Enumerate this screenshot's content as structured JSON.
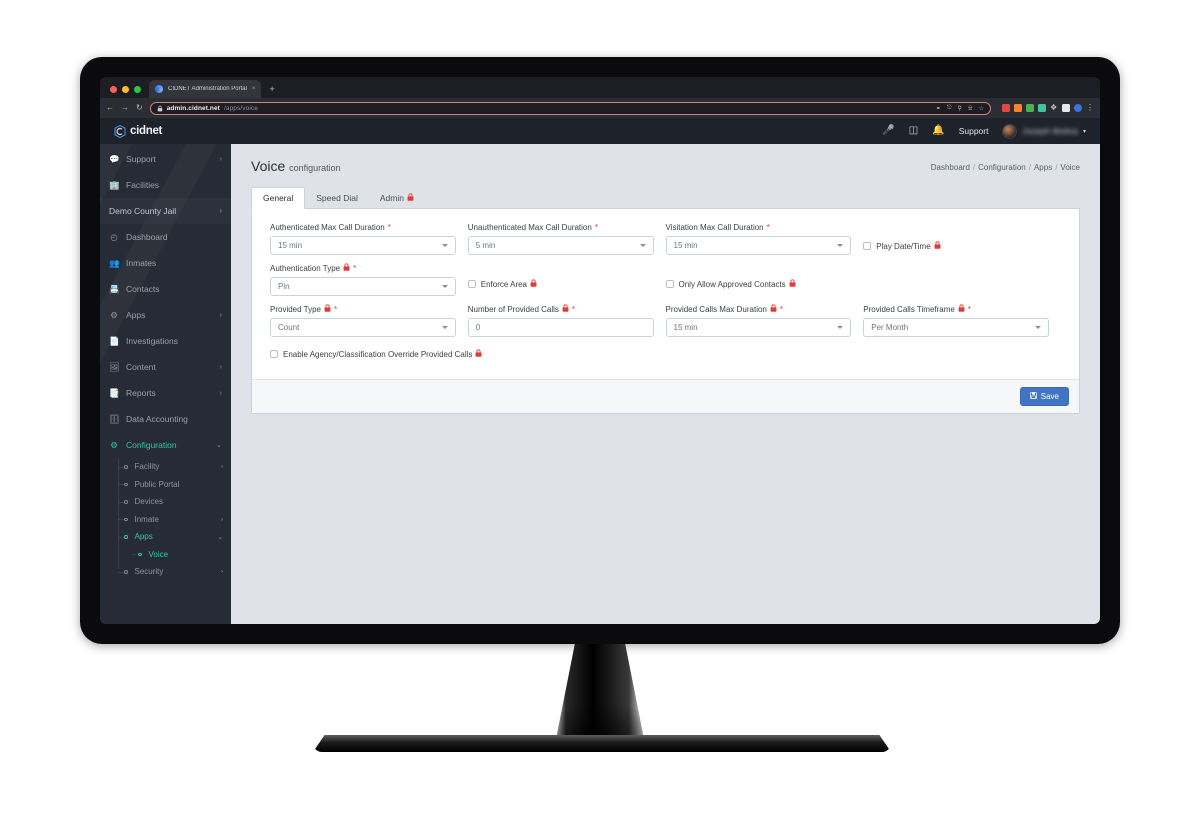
{
  "browser": {
    "tab_title": "CIDNET Administration Portal",
    "tab_close": "×",
    "new_tab": "+",
    "back": "←",
    "forward": "→",
    "reload": "↻",
    "lock_icon": "ὑ2",
    "url_host": "admin.cidnet.net",
    "url_path": "/apps/voice",
    "omni_icons": [
      "key-icon",
      "share-icon",
      "zoom-icon",
      "print-icon",
      "bookmark-star-icon"
    ],
    "ext_icons": [
      "red-extension",
      "orange-extension",
      "green-extension",
      "teal-extension",
      "puzzle-extension",
      "white-extension",
      "blue-profile",
      "kebab-menu"
    ]
  },
  "app": {
    "logo_text": "cidnet",
    "header_icons": [
      "microphone-icon",
      "package-icon",
      "bell-icon"
    ],
    "support_label": "Support",
    "user_name": "Joseph Molina",
    "user_caret": "▾"
  },
  "sidebar": {
    "items": [
      {
        "label": "Support",
        "icon": "💬",
        "chevron": "›",
        "type": "item"
      },
      {
        "label": "Facilities",
        "icon": "🏢",
        "chevron": "",
        "type": "item"
      },
      {
        "label": "Demo County Jail",
        "icon": "",
        "chevron": "›",
        "type": "site"
      },
      {
        "label": "Dashboard",
        "icon": "◴",
        "chevron": "",
        "type": "item"
      },
      {
        "label": "Inmates",
        "icon": "👥",
        "chevron": "",
        "type": "item"
      },
      {
        "label": "Contacts",
        "icon": "📇",
        "chevron": "",
        "type": "item"
      },
      {
        "label": "Apps",
        "icon": "⚙",
        "chevron": "›",
        "type": "item"
      },
      {
        "label": "Investigations",
        "icon": "📄",
        "chevron": "",
        "type": "item"
      },
      {
        "label": "Content",
        "icon": "🖼",
        "chevron": "›",
        "type": "item"
      },
      {
        "label": "Reports",
        "icon": "📑",
        "chevron": "›",
        "type": "item"
      },
      {
        "label": "Data Accounting",
        "icon": "🗄",
        "chevron": "",
        "type": "item"
      },
      {
        "label": "Configuration",
        "icon": "⚙",
        "chevron": "⌄",
        "type": "group-open"
      }
    ],
    "sub_items": [
      {
        "label": "Facility",
        "chevron": "›",
        "state": "off",
        "level": 1
      },
      {
        "label": "Public Portal",
        "chevron": "",
        "state": "off",
        "level": 1
      },
      {
        "label": "Devices",
        "chevron": "",
        "state": "off",
        "level": 1
      },
      {
        "label": "Inmate",
        "chevron": "›",
        "state": "off",
        "level": 1
      },
      {
        "label": "Apps",
        "chevron": "⌄",
        "state": "on",
        "level": 1
      },
      {
        "label": "Voice",
        "chevron": "",
        "state": "current",
        "level": 2
      },
      {
        "label": "Security",
        "chevron": "›",
        "state": "off",
        "level": 1
      }
    ]
  },
  "page": {
    "title_main": "Voice",
    "title_sub": "configuration",
    "breadcrumb": [
      "Dashboard",
      "Configuration",
      "Apps",
      "Voice"
    ],
    "breadcrumb_sep": "/"
  },
  "tabs": [
    {
      "label": "General",
      "selected": true,
      "lock": false
    },
    {
      "label": "Speed Dial",
      "selected": false,
      "lock": false
    },
    {
      "label": "Admin",
      "selected": false,
      "lock": true
    }
  ],
  "form": {
    "lock_glyph": "🔒",
    "required_glyph": "*",
    "fields": {
      "authenticated_max_call_duration": {
        "label": "Authenticated Max Call Duration",
        "value": "15 min",
        "required": true,
        "lock": false,
        "control": "select"
      },
      "unauthenticated_max_call_duration": {
        "label": "Unauthenticated Max Call Duration",
        "value": "5 min",
        "required": true,
        "lock": false,
        "control": "select"
      },
      "visitation_max_call_duration": {
        "label": "Visitation Max Call Duration",
        "value": "15 min",
        "required": true,
        "lock": false,
        "control": "select"
      },
      "play_date_time": {
        "label": "Play Date/Time",
        "checked": false,
        "lock": true,
        "control": "checkbox"
      },
      "authentication_type": {
        "label": "Authentication Type",
        "value": "Pin",
        "required": true,
        "lock": true,
        "control": "select"
      },
      "enforce_area": {
        "label": "Enforce Area",
        "checked": false,
        "lock": true,
        "control": "checkbox"
      },
      "only_allow_approved_contacts": {
        "label": "Only Allow Approved Contacts",
        "checked": false,
        "lock": true,
        "control": "checkbox"
      },
      "provided_type": {
        "label": "Provided Type",
        "value": "Count",
        "required": true,
        "lock": true,
        "control": "select"
      },
      "number_of_provided_calls": {
        "label": "Number of Provided Calls",
        "value": "0",
        "required": true,
        "lock": true,
        "control": "text"
      },
      "provided_calls_max_duration": {
        "label": "Provided Calls Max Duration",
        "value": "15 min",
        "required": true,
        "lock": true,
        "control": "select"
      },
      "provided_calls_timeframe": {
        "label": "Provided Calls Timeframe",
        "value": "Per Month",
        "required": true,
        "lock": true,
        "control": "select"
      },
      "enable_agency_override": {
        "label": "Enable Agency/Classification Override Provided Calls",
        "checked": false,
        "lock": true,
        "control": "checkbox"
      }
    },
    "save_label": "Save",
    "save_icon": "💾"
  },
  "colors": {
    "accent_teal": "#37c4ac",
    "primary_blue": "#4274c4",
    "required_red": "#e23b3b",
    "lock_red": "#e23b3b",
    "sidebar_bg": "#262b35",
    "header_bg": "#1e222b",
    "content_bg": "#dfe3e9"
  }
}
